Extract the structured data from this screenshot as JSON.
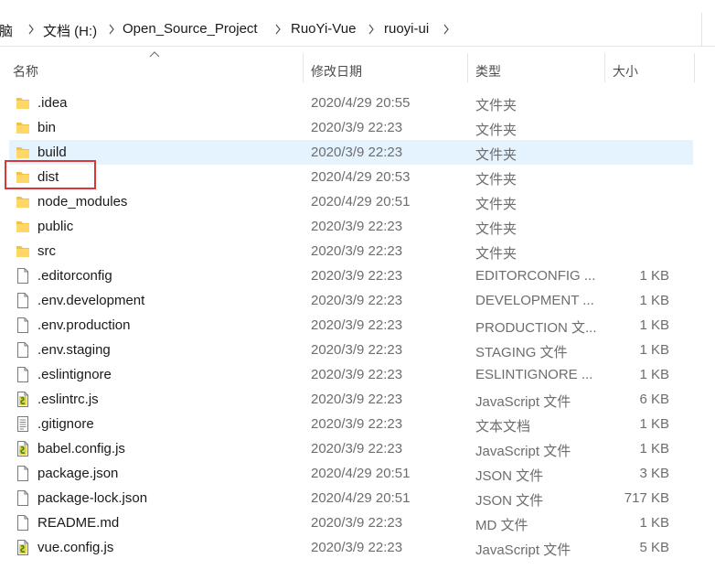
{
  "address_bar": {
    "segments": [
      "电脑",
      "文档 (H:)",
      "Open_Source_Project",
      "RuoYi-Vue",
      "ruoyi-ui"
    ]
  },
  "columns": {
    "name": "名称",
    "modified": "修改日期",
    "type": "类型",
    "size": "大小"
  },
  "colors": {
    "folder": "#f4c04a",
    "selected_row": "#e5f3ff",
    "highlight_box": "#d9383a"
  },
  "files": [
    {
      "name": ".idea",
      "modified": "2020/4/29 20:55",
      "type": "文件夹",
      "size": "",
      "icon": "folder-icon"
    },
    {
      "name": "bin",
      "modified": "2020/3/9 22:23",
      "type": "文件夹",
      "size": "",
      "icon": "folder-icon"
    },
    {
      "name": "build",
      "modified": "2020/3/9 22:23",
      "type": "文件夹",
      "size": "",
      "icon": "folder-icon"
    },
    {
      "name": "dist",
      "modified": "2020/4/29 20:53",
      "type": "文件夹",
      "size": "",
      "icon": "folder-icon"
    },
    {
      "name": "node_modules",
      "modified": "2020/4/29 20:51",
      "type": "文件夹",
      "size": "",
      "icon": "folder-icon"
    },
    {
      "name": "public",
      "modified": "2020/3/9 22:23",
      "type": "文件夹",
      "size": "",
      "icon": "folder-icon"
    },
    {
      "name": "src",
      "modified": "2020/3/9 22:23",
      "type": "文件夹",
      "size": "",
      "icon": "folder-icon"
    },
    {
      "name": ".editorconfig",
      "modified": "2020/3/9 22:23",
      "type": "EDITORCONFIG ...",
      "size": "1 KB",
      "icon": "file-icon"
    },
    {
      "name": ".env.development",
      "modified": "2020/3/9 22:23",
      "type": "DEVELOPMENT ...",
      "size": "1 KB",
      "icon": "file-icon"
    },
    {
      "name": ".env.production",
      "modified": "2020/3/9 22:23",
      "type": "PRODUCTION 文...",
      "size": "1 KB",
      "icon": "file-icon"
    },
    {
      "name": ".env.staging",
      "modified": "2020/3/9 22:23",
      "type": "STAGING 文件",
      "size": "1 KB",
      "icon": "file-icon"
    },
    {
      "name": ".eslintignore",
      "modified": "2020/3/9 22:23",
      "type": "ESLINTIGNORE ...",
      "size": "1 KB",
      "icon": "file-icon"
    },
    {
      "name": ".eslintrc.js",
      "modified": "2020/3/9 22:23",
      "type": "JavaScript 文件",
      "size": "6 KB",
      "icon": "js-file-icon"
    },
    {
      "name": ".gitignore",
      "modified": "2020/3/9 22:23",
      "type": "文本文档",
      "size": "1 KB",
      "icon": "text-file-icon"
    },
    {
      "name": "babel.config.js",
      "modified": "2020/3/9 22:23",
      "type": "JavaScript 文件",
      "size": "1 KB",
      "icon": "js-file-icon"
    },
    {
      "name": "package.json",
      "modified": "2020/4/29 20:51",
      "type": "JSON 文件",
      "size": "3 KB",
      "icon": "file-icon"
    },
    {
      "name": "package-lock.json",
      "modified": "2020/4/29 20:51",
      "type": "JSON 文件",
      "size": "717 KB",
      "icon": "file-icon"
    },
    {
      "name": "README.md",
      "modified": "2020/3/9 22:23",
      "type": "MD 文件",
      "size": "1 KB",
      "icon": "file-icon"
    },
    {
      "name": "vue.config.js",
      "modified": "2020/3/9 22:23",
      "type": "JavaScript 文件",
      "size": "5 KB",
      "icon": "js-file-icon"
    }
  ]
}
